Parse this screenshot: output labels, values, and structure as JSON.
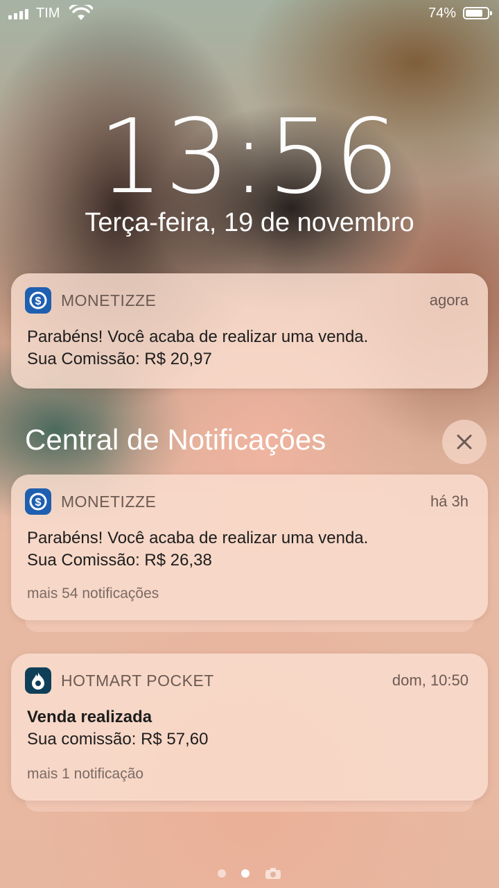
{
  "status_bar": {
    "carrier": "TIM",
    "battery": "74%"
  },
  "lock_screen": {
    "time": "13:56",
    "date": "Terça-feira, 19 de novembro"
  },
  "notification_top": {
    "app": "MONETIZZE",
    "time": "agora",
    "line1": "Parabéns! Você acaba de realizar uma venda.",
    "line2": "Sua Comissão: R$ 20,97"
  },
  "notification_center": {
    "title": "Central de Notificações"
  },
  "notification_group_monetizze": {
    "app": "MONETIZZE",
    "time": "há 3h",
    "line1": "Parabéns! Você acaba de realizar uma venda.",
    "line2": "Sua Comissão: R$ 26,38",
    "more": "mais 54 notificações"
  },
  "notification_group_hotmart": {
    "app": "HOTMART POCKET",
    "time": "dom, 10:50",
    "title": "Venda realizada",
    "line1": "Sua comissão: R$ 57,60",
    "more": "mais 1 notificação"
  },
  "colors": {
    "monetizze_icon": "#1f5fb0",
    "hotmart_icon": "#0f3f58",
    "hotmart_flame": "#f04e23"
  },
  "icons": [
    "signal-icon",
    "wifi-icon",
    "battery-icon",
    "monetizze-app-icon",
    "hotmart-app-icon",
    "close-icon",
    "camera-icon"
  ]
}
